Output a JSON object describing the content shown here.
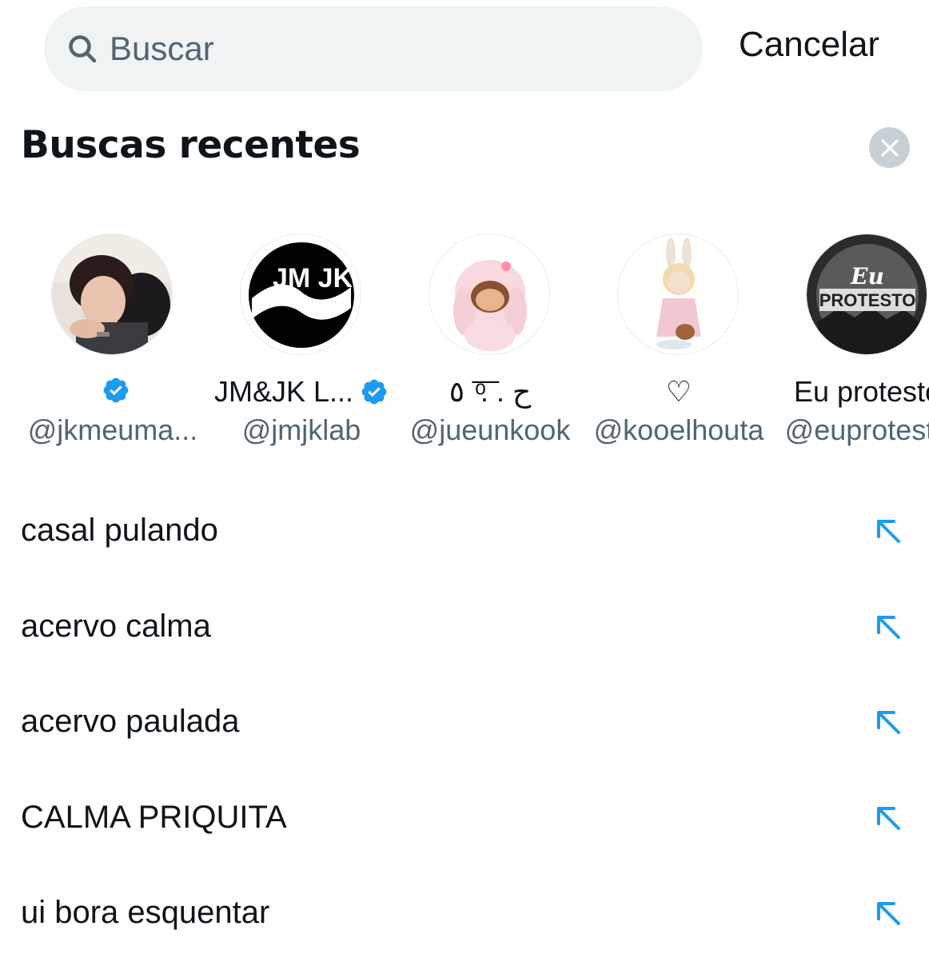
{
  "search": {
    "placeholder": "Buscar",
    "value": ""
  },
  "cancel_label": "Cancelar",
  "section": {
    "title": "Buscas recentes"
  },
  "accounts": [
    {
      "name": "",
      "verified": true,
      "handle": "@jkmeuma...",
      "avatar_hint": "photo-two-people"
    },
    {
      "name": "JM&JK L...",
      "verified": true,
      "handle": "@jmjklab",
      "avatar_hint": "jmjk-logo"
    },
    {
      "name": "ح . . ͦ͞ ٥",
      "verified": false,
      "handle": "@jueunkook",
      "avatar_hint": "pink-plush-toy"
    },
    {
      "name": "♡",
      "verified": false,
      "handle": "@kooelhouta",
      "avatar_hint": "bunny-figurine"
    },
    {
      "name": "Eu protesto",
      "verified": false,
      "handle": "@euprotesto",
      "avatar_hint": "eu-protesto-logo"
    }
  ],
  "avatar_texts": {
    "jmjk": "JM JK",
    "eu": "Eu",
    "protesto": "PROTESTO"
  },
  "recent_searches": [
    {
      "label": "casal pulando"
    },
    {
      "label": "acervo calma"
    },
    {
      "label": "acervo paulada"
    },
    {
      "label": "CALMA PRIQUITA"
    },
    {
      "label": "ui bora esquentar"
    }
  ],
  "colors": {
    "accent": "#1d9bf0",
    "search_bg": "#eff3f4",
    "secondary_text": "#536471",
    "clear_button_bg": "#c6d0d6"
  }
}
